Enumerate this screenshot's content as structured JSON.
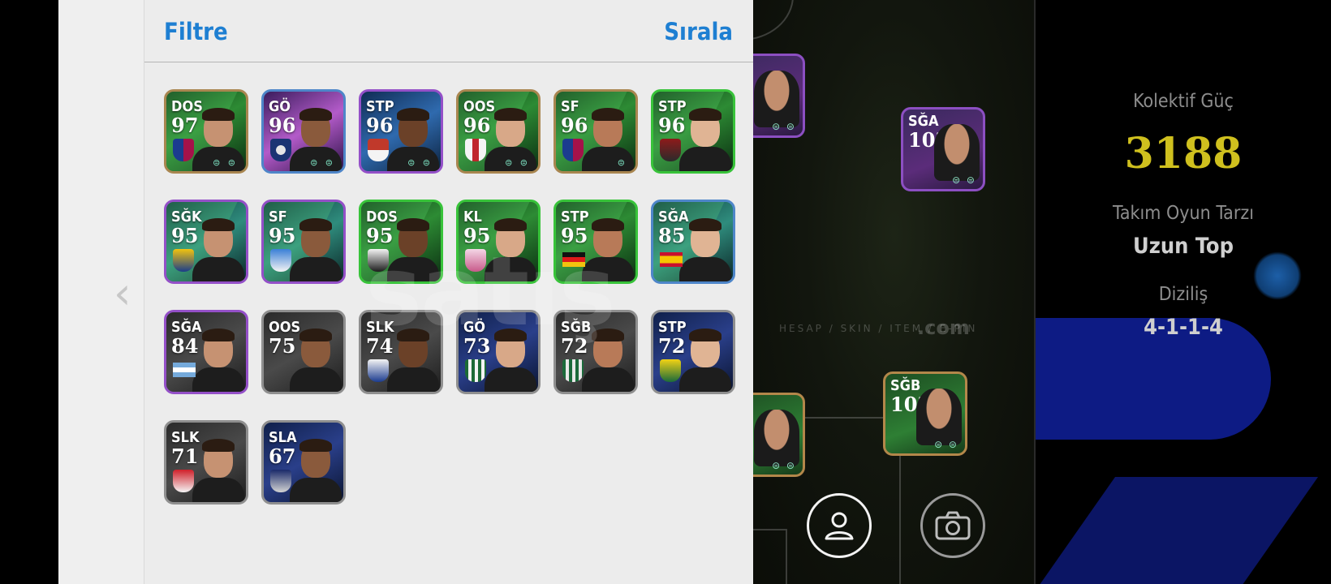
{
  "panel": {
    "filter_label": "Filtre",
    "sort_label": "Sırala",
    "prev_chevron": "‹"
  },
  "players": [
    {
      "pos": "DOS",
      "rating": "97",
      "rarity": "gold",
      "bg": "green",
      "badge": "barcelona",
      "flag": false,
      "dots": "⊜ ⊜"
    },
    {
      "pos": "GÖ",
      "rating": "96",
      "rarity": "blue",
      "bg": "purple",
      "badge": "psg",
      "flag": false,
      "dots": "⊜ ⊜"
    },
    {
      "pos": "STP",
      "rating": "96",
      "rarity": "purple",
      "bg": "blue",
      "badge": "red-white",
      "flag": false,
      "dots": "⊜ ⊜"
    },
    {
      "pos": "OOS",
      "rating": "96",
      "rarity": "gold",
      "bg": "green",
      "badge": "ajax",
      "flag": false,
      "dots": "⊜ ⊜"
    },
    {
      "pos": "SF",
      "rating": "96",
      "rarity": "gold",
      "bg": "green",
      "badge": "barcelona",
      "flag": false,
      "dots": "⊜"
    },
    {
      "pos": "STP",
      "rating": "96",
      "rarity": "green",
      "bg": "green",
      "badge": "red-shield",
      "flag": false,
      "dots": ""
    },
    {
      "pos": "SĞK",
      "rating": "95",
      "rarity": "purple",
      "bg": "teal",
      "badge": "yellow-crest",
      "flag": false,
      "dots": ""
    },
    {
      "pos": "SF",
      "rating": "95",
      "rarity": "purple",
      "bg": "teal",
      "badge": "blue-crest",
      "flag": false,
      "dots": ""
    },
    {
      "pos": "DOS",
      "rating": "95",
      "rarity": "green",
      "bg": "green",
      "badge": "white-crest",
      "flag": false,
      "dots": ""
    },
    {
      "pos": "KL",
      "rating": "95",
      "rarity": "green",
      "bg": "green",
      "badge": "pink-crest",
      "flag": false,
      "dots": ""
    },
    {
      "pos": "STP",
      "rating": "95",
      "rarity": "green",
      "bg": "green",
      "badge": "germany",
      "flag": true,
      "dots": ""
    },
    {
      "pos": "SĞA",
      "rating": "85",
      "rarity": "blue",
      "bg": "teal",
      "badge": "spain",
      "flag": true,
      "dots": ""
    },
    {
      "pos": "SĞA",
      "rating": "84",
      "rarity": "purple",
      "bg": "dark",
      "badge": "argentina",
      "flag": true,
      "dots": ""
    },
    {
      "pos": "OOS",
      "rating": "75",
      "rarity": "grey",
      "bg": "dark",
      "badge": "none",
      "flag": false,
      "dots": ""
    },
    {
      "pos": "SLK",
      "rating": "74",
      "rarity": "grey",
      "bg": "dark",
      "badge": "lyon",
      "flag": false,
      "dots": ""
    },
    {
      "pos": "GÖ",
      "rating": "73",
      "rarity": "grey",
      "bg": "navy",
      "badge": "green-stripe",
      "flag": false,
      "dots": ""
    },
    {
      "pos": "SĞB",
      "rating": "72",
      "rarity": "grey",
      "bg": "dark",
      "badge": "green-crest",
      "flag": false,
      "dots": ""
    },
    {
      "pos": "STP",
      "rating": "72",
      "rarity": "grey",
      "bg": "navy",
      "badge": "nantes",
      "flag": false,
      "dots": ""
    },
    {
      "pos": "SLK",
      "rating": "71",
      "rarity": "grey",
      "bg": "dark",
      "badge": "red-crest",
      "flag": false,
      "dots": ""
    },
    {
      "pos": "SLA",
      "rating": "67",
      "rarity": "grey",
      "bg": "navy",
      "badge": "navy-crest",
      "flag": false,
      "dots": ""
    }
  ],
  "pitch": {
    "cards": [
      {
        "pos": "SĞA",
        "rating": "103"
      },
      {
        "pos": "SĞB",
        "rating": "103"
      }
    ],
    "watermark": "satış",
    "watermark_sub": "HESAP / SKIN / ITEM / E-PIN",
    "watermark_com": ".com"
  },
  "stats": {
    "power_label": "Kolektif Güç",
    "power_value": "3188",
    "style_label": "Takım Oyun Tarzı",
    "style_value": "Uzun Top",
    "formation_label": "Diziliş",
    "formation_value": "4-1-1-4"
  },
  "icons": {
    "profile": "user-icon",
    "camera": "camera-icon"
  },
  "colors": {
    "accent_blue": "#1e7fd2",
    "power_yellow": "#cfc01e",
    "panel_bg": "#ececec"
  }
}
